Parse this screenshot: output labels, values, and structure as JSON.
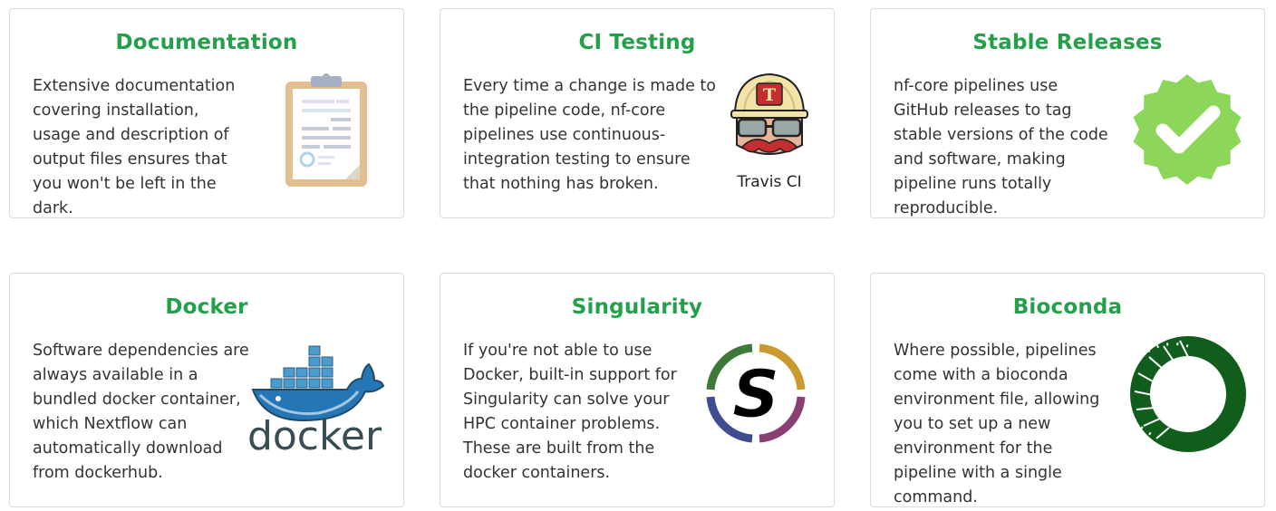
{
  "features": [
    {
      "title": "Documentation",
      "text": "Extensive documentation covering installation, usage and description of output files ensures that you won't be left in the dark.",
      "icon": "clipboard-icon"
    },
    {
      "title": "CI Testing",
      "text": "Every time a change is made to the pipeline code, nf-core pipelines use continuous-integration testing to ensure that nothing has broken.",
      "icon": "travis-ci-logo",
      "icon_label": "Travis CI"
    },
    {
      "title": "Stable Releases",
      "text": "nf-core pipelines use GitHub releases to tag stable versions of the code and software, making pipeline runs totally reproducible.",
      "icon": "checkmark-badge-icon"
    },
    {
      "title": "Docker",
      "text": "Software dependencies are always available in a bundled docker container, which Nextflow can automatically download from dockerhub.",
      "icon": "docker-logo",
      "icon_label": "docker"
    },
    {
      "title": "Singularity",
      "text": "If you're not able to use Docker, built-in support for Singularity can solve your HPC container problems. These are built from the docker containers.",
      "icon": "singularity-logo",
      "icon_label": "S"
    },
    {
      "title": "Bioconda",
      "text": "Where possible, pipelines come with a bioconda environment file, allowing you to set up a new environment for the pipeline with a single command.",
      "icon": "bioconda-logo"
    }
  ],
  "colors": {
    "title": "#22a04a",
    "text": "#333333",
    "border": "#dcdcdc"
  }
}
